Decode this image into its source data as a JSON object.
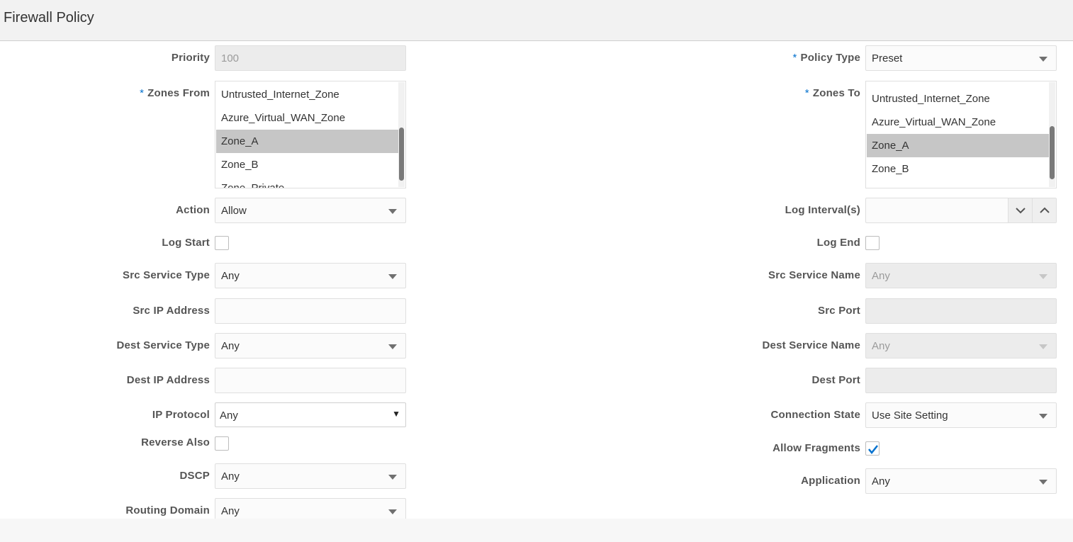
{
  "header": {
    "title": "Firewall Policy"
  },
  "left": {
    "priority": {
      "label": "Priority",
      "value": "100"
    },
    "zones_from": {
      "label": "Zones From",
      "required": "*",
      "items": [
        "Untrusted_Internet_Zone",
        "Azure_Virtual_WAN_Zone",
        "Zone_A",
        "Zone_B",
        "Zone_Private"
      ],
      "selected": "Zone_A"
    },
    "action": {
      "label": "Action",
      "value": "Allow"
    },
    "log_start": {
      "label": "Log Start",
      "checked": false
    },
    "src_service_type": {
      "label": "Src Service Type",
      "value": "Any"
    },
    "src_ip_address": {
      "label": "Src IP Address",
      "value": ""
    },
    "dest_service_type": {
      "label": "Dest Service Type",
      "value": "Any"
    },
    "dest_ip_address": {
      "label": "Dest IP Address",
      "value": ""
    },
    "ip_protocol": {
      "label": "IP Protocol",
      "value": "Any"
    },
    "reverse_also": {
      "label": "Reverse Also",
      "checked": false
    },
    "dscp": {
      "label": "DSCP",
      "value": "Any"
    },
    "routing_domain": {
      "label": "Routing Domain",
      "value": "Any"
    }
  },
  "right": {
    "policy_type": {
      "label": "Policy Type",
      "required": "*",
      "value": "Preset"
    },
    "zones_to": {
      "label": "Zones To",
      "required": "*",
      "items": [
        "Untrusted_Internet_Zone",
        "Azure_Virtual_WAN_Zone",
        "Zone_A",
        "Zone_B"
      ],
      "selected": "Zone_A"
    },
    "log_interval": {
      "label": "Log Interval(s)",
      "value": ""
    },
    "log_end": {
      "label": "Log End",
      "checked": false
    },
    "src_service_name": {
      "label": "Src Service Name",
      "value": "Any"
    },
    "src_port": {
      "label": "Src Port",
      "value": ""
    },
    "dest_service_name": {
      "label": "Dest Service Name",
      "value": "Any"
    },
    "dest_port": {
      "label": "Dest Port",
      "value": ""
    },
    "connection_state": {
      "label": "Connection State",
      "value": "Use Site Setting"
    },
    "allow_fragments": {
      "label": "Allow Fragments",
      "checked": true
    },
    "application": {
      "label": "Application",
      "value": "Any"
    }
  },
  "colors": {
    "accent": "#0572ce",
    "selected_row": "#c6c6c6",
    "readonly_bg": "#ececec"
  }
}
